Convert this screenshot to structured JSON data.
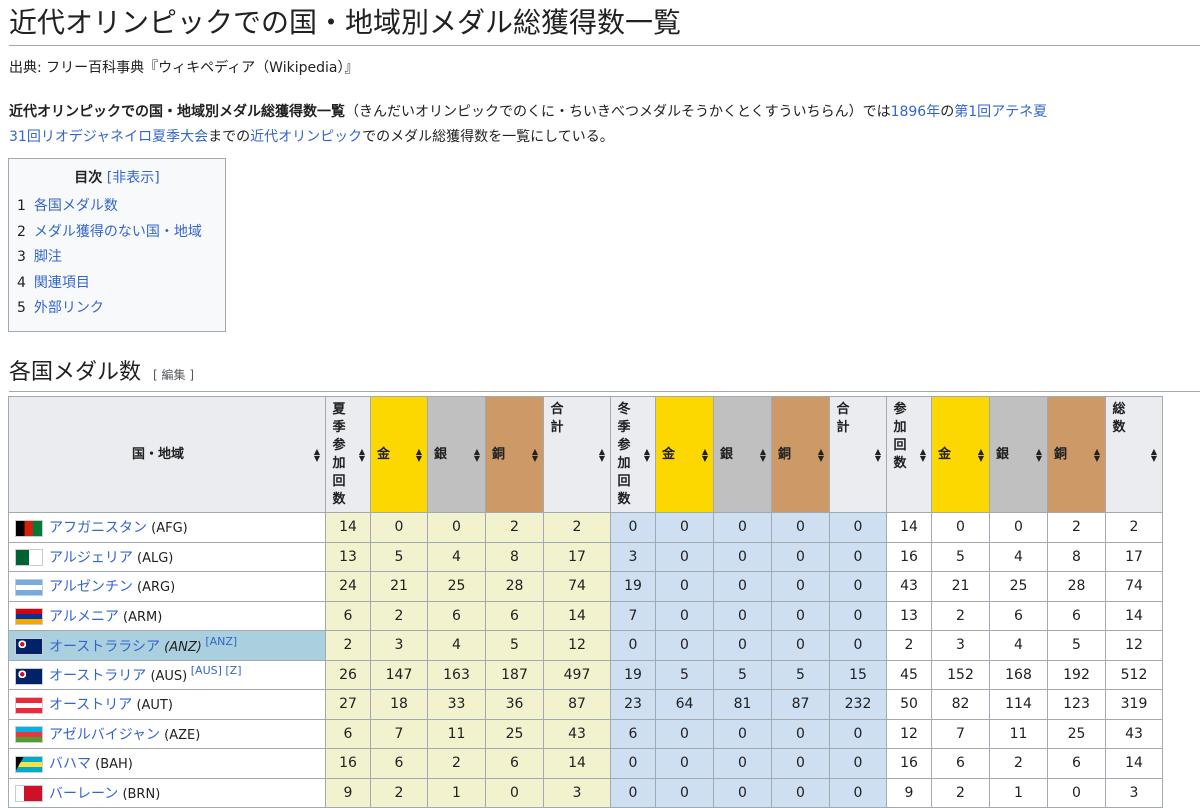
{
  "page": {
    "title": "近代オリンピックでの国・地域別メダル総獲得数一覧",
    "source": "出典: フリー百科事典『ウィキペディア（Wikipedia）』",
    "intro": {
      "bold": "近代オリンピックでの国・地域別メダル総獲得数一覧",
      "reading": "（きんだいオリンピックでのくに・ちいきべつメダルそうかくとくすういちらん）では",
      "link1": "1896年",
      "of": "の",
      "link2": "第1回アテネ夏",
      "line2_link1": "31回リオデジャネイロ夏季大会",
      "line2_mid": "までの",
      "line2_link2": "近代オリンピック",
      "line2_end": "でのメダル総獲得数を一覧にしている。"
    }
  },
  "toc": {
    "title": "目次",
    "toggle": "[非表示]",
    "items": [
      {
        "num": "1",
        "label": "各国メダル数"
      },
      {
        "num": "2",
        "label": "メダル獲得のない国・地域"
      },
      {
        "num": "3",
        "label": "脚注"
      },
      {
        "num": "4",
        "label": "関連項目"
      },
      {
        "num": "5",
        "label": "外部リンク"
      }
    ]
  },
  "section": {
    "title": "各国メダル数",
    "edit": "[ 編集 ]"
  },
  "table": {
    "headers": [
      {
        "label": "国・地域",
        "cls": "country"
      },
      {
        "label": "夏季参加回数",
        "cls": "plain vert"
      },
      {
        "label": "金",
        "cls": "gold"
      },
      {
        "label": "銀",
        "cls": "silver"
      },
      {
        "label": "銅",
        "cls": "bronze"
      },
      {
        "label": "合計",
        "cls": "plain vert"
      },
      {
        "label": "冬季参加回数",
        "cls": "plain vert"
      },
      {
        "label": "金",
        "cls": "gold"
      },
      {
        "label": "銀",
        "cls": "silver"
      },
      {
        "label": "銅",
        "cls": "bronze"
      },
      {
        "label": "合計",
        "cls": "plain vert"
      },
      {
        "label": "参加回数",
        "cls": "plain vert"
      },
      {
        "label": "金",
        "cls": "gold"
      },
      {
        "label": "銀",
        "cls": "silver"
      },
      {
        "label": "銅",
        "cls": "bronze"
      },
      {
        "label": "総数",
        "cls": "plain vert"
      }
    ],
    "rows": [
      {
        "name": "アフガニスタン",
        "code": "(AFG)",
        "flag": "afghanistan-flag-icon",
        "notes": "",
        "hist": false,
        "values": [
          "14",
          "0",
          "0",
          "2",
          "2",
          "0",
          "0",
          "0",
          "0",
          "0",
          "14",
          "0",
          "0",
          "2",
          "2"
        ]
      },
      {
        "name": "アルジェリア",
        "code": "(ALG)",
        "flag": "algeria-flag-icon",
        "notes": "",
        "hist": false,
        "values": [
          "13",
          "5",
          "4",
          "8",
          "17",
          "3",
          "0",
          "0",
          "0",
          "0",
          "16",
          "5",
          "4",
          "8",
          "17"
        ]
      },
      {
        "name": "アルゼンチン",
        "code": "(ARG)",
        "flag": "argentina-flag-icon",
        "notes": "",
        "hist": false,
        "values": [
          "24",
          "21",
          "25",
          "28",
          "74",
          "19",
          "0",
          "0",
          "0",
          "0",
          "43",
          "21",
          "25",
          "28",
          "74"
        ]
      },
      {
        "name": "アルメニア",
        "code": "(ARM)",
        "flag": "armenia-flag-icon",
        "notes": "",
        "hist": false,
        "values": [
          "6",
          "2",
          "6",
          "6",
          "14",
          "7",
          "0",
          "0",
          "0",
          "0",
          "13",
          "2",
          "6",
          "6",
          "14"
        ]
      },
      {
        "name": "オーストララシア",
        "code": "(ANZ)",
        "flag": "australasia-flag-icon",
        "notes": "[ANZ]",
        "hist": true,
        "values": [
          "2",
          "3",
          "4",
          "5",
          "12",
          "0",
          "0",
          "0",
          "0",
          "0",
          "2",
          "3",
          "4",
          "5",
          "12"
        ]
      },
      {
        "name": "オーストラリア",
        "code": "(AUS)",
        "flag": "australia-flag-icon",
        "notes": "[AUS] [Z]",
        "hist": false,
        "values": [
          "26",
          "147",
          "163",
          "187",
          "497",
          "19",
          "5",
          "5",
          "5",
          "15",
          "45",
          "152",
          "168",
          "192",
          "512"
        ]
      },
      {
        "name": "オーストリア",
        "code": "(AUT)",
        "flag": "austria-flag-icon",
        "notes": "",
        "hist": false,
        "values": [
          "27",
          "18",
          "33",
          "36",
          "87",
          "23",
          "64",
          "81",
          "87",
          "232",
          "50",
          "82",
          "114",
          "123",
          "319"
        ]
      },
      {
        "name": "アゼルバイジャン",
        "code": "(AZE)",
        "flag": "azerbaijan-flag-icon",
        "notes": "",
        "hist": false,
        "values": [
          "6",
          "7",
          "11",
          "25",
          "43",
          "6",
          "0",
          "0",
          "0",
          "0",
          "12",
          "7",
          "11",
          "25",
          "43"
        ]
      },
      {
        "name": "バハマ",
        "code": "(BAH)",
        "flag": "bahamas-flag-icon",
        "notes": "",
        "hist": false,
        "values": [
          "16",
          "6",
          "2",
          "6",
          "14",
          "0",
          "0",
          "0",
          "0",
          "0",
          "16",
          "6",
          "2",
          "6",
          "14"
        ]
      },
      {
        "name": "バーレーン",
        "code": "(BRN)",
        "flag": "bahrain-flag-icon",
        "notes": "",
        "hist": false,
        "values": [
          "9",
          "2",
          "1",
          "0",
          "3",
          "0",
          "0",
          "0",
          "0",
          "0",
          "9",
          "2",
          "1",
          "0",
          "3"
        ]
      }
    ]
  },
  "colors": {
    "gold": "#fcd700",
    "silver": "#c0c0c0",
    "bronze": "#cd9966",
    "summer": "#f2f2ce",
    "winter": "#cedff2",
    "historic": "#aad0e0",
    "link": "#3366cc"
  }
}
